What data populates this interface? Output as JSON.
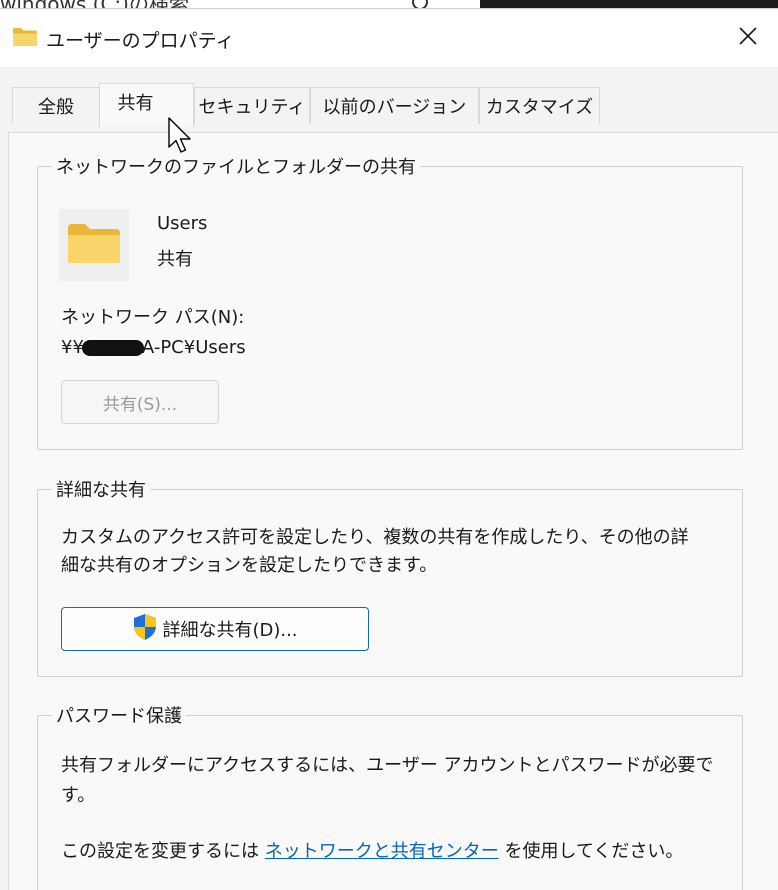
{
  "background_window": {
    "search_text": "windows (C:)の検索"
  },
  "titlebar": {
    "title": "ユーザーのプロパティ",
    "close_glyph": "✕"
  },
  "tabs": [
    {
      "label": "全般"
    },
    {
      "label": "共有",
      "active": true
    },
    {
      "label": "セキュリティ"
    },
    {
      "label": "以前のバージョン"
    },
    {
      "label": "カスタマイズ"
    }
  ],
  "network_sharing": {
    "legend": "ネットワークのファイルとフォルダーの共有",
    "folder_name": "Users",
    "share_status": "共有",
    "path_label": "ネットワーク パス(N):",
    "path_prefix": "¥¥",
    "path_suffix": "A-PC¥Users",
    "share_button": "共有(S)..."
  },
  "advanced_sharing": {
    "legend": "詳細な共有",
    "description_line1": "カスタムのアクセス許可を設定したり、複数の共有を作成したり、その他の詳",
    "description_line2": "細な共有のオプションを設定したりできます。",
    "button_label": "詳細な共有(D)..."
  },
  "password_protection": {
    "legend": "パスワード保護",
    "description_line1": "共有フォルダーにアクセスするには、ユーザー アカウントとパスワードが必要で",
    "description_line2": "す。",
    "change_prefix": "この設定を変更するには",
    "link_label": "ネットワークと共有センター",
    "change_suffix": "を使用してください。"
  },
  "icons": {
    "title": "folder-icon",
    "folder_tile": "folder-icon",
    "advanced_button": "uac-shield-icon",
    "close": "close-icon",
    "cursor": "mouse-pointer-icon"
  },
  "colors": {
    "accent": "#0f6cbd",
    "link": "#0067c0",
    "folder_yellow": "#f8d568"
  }
}
